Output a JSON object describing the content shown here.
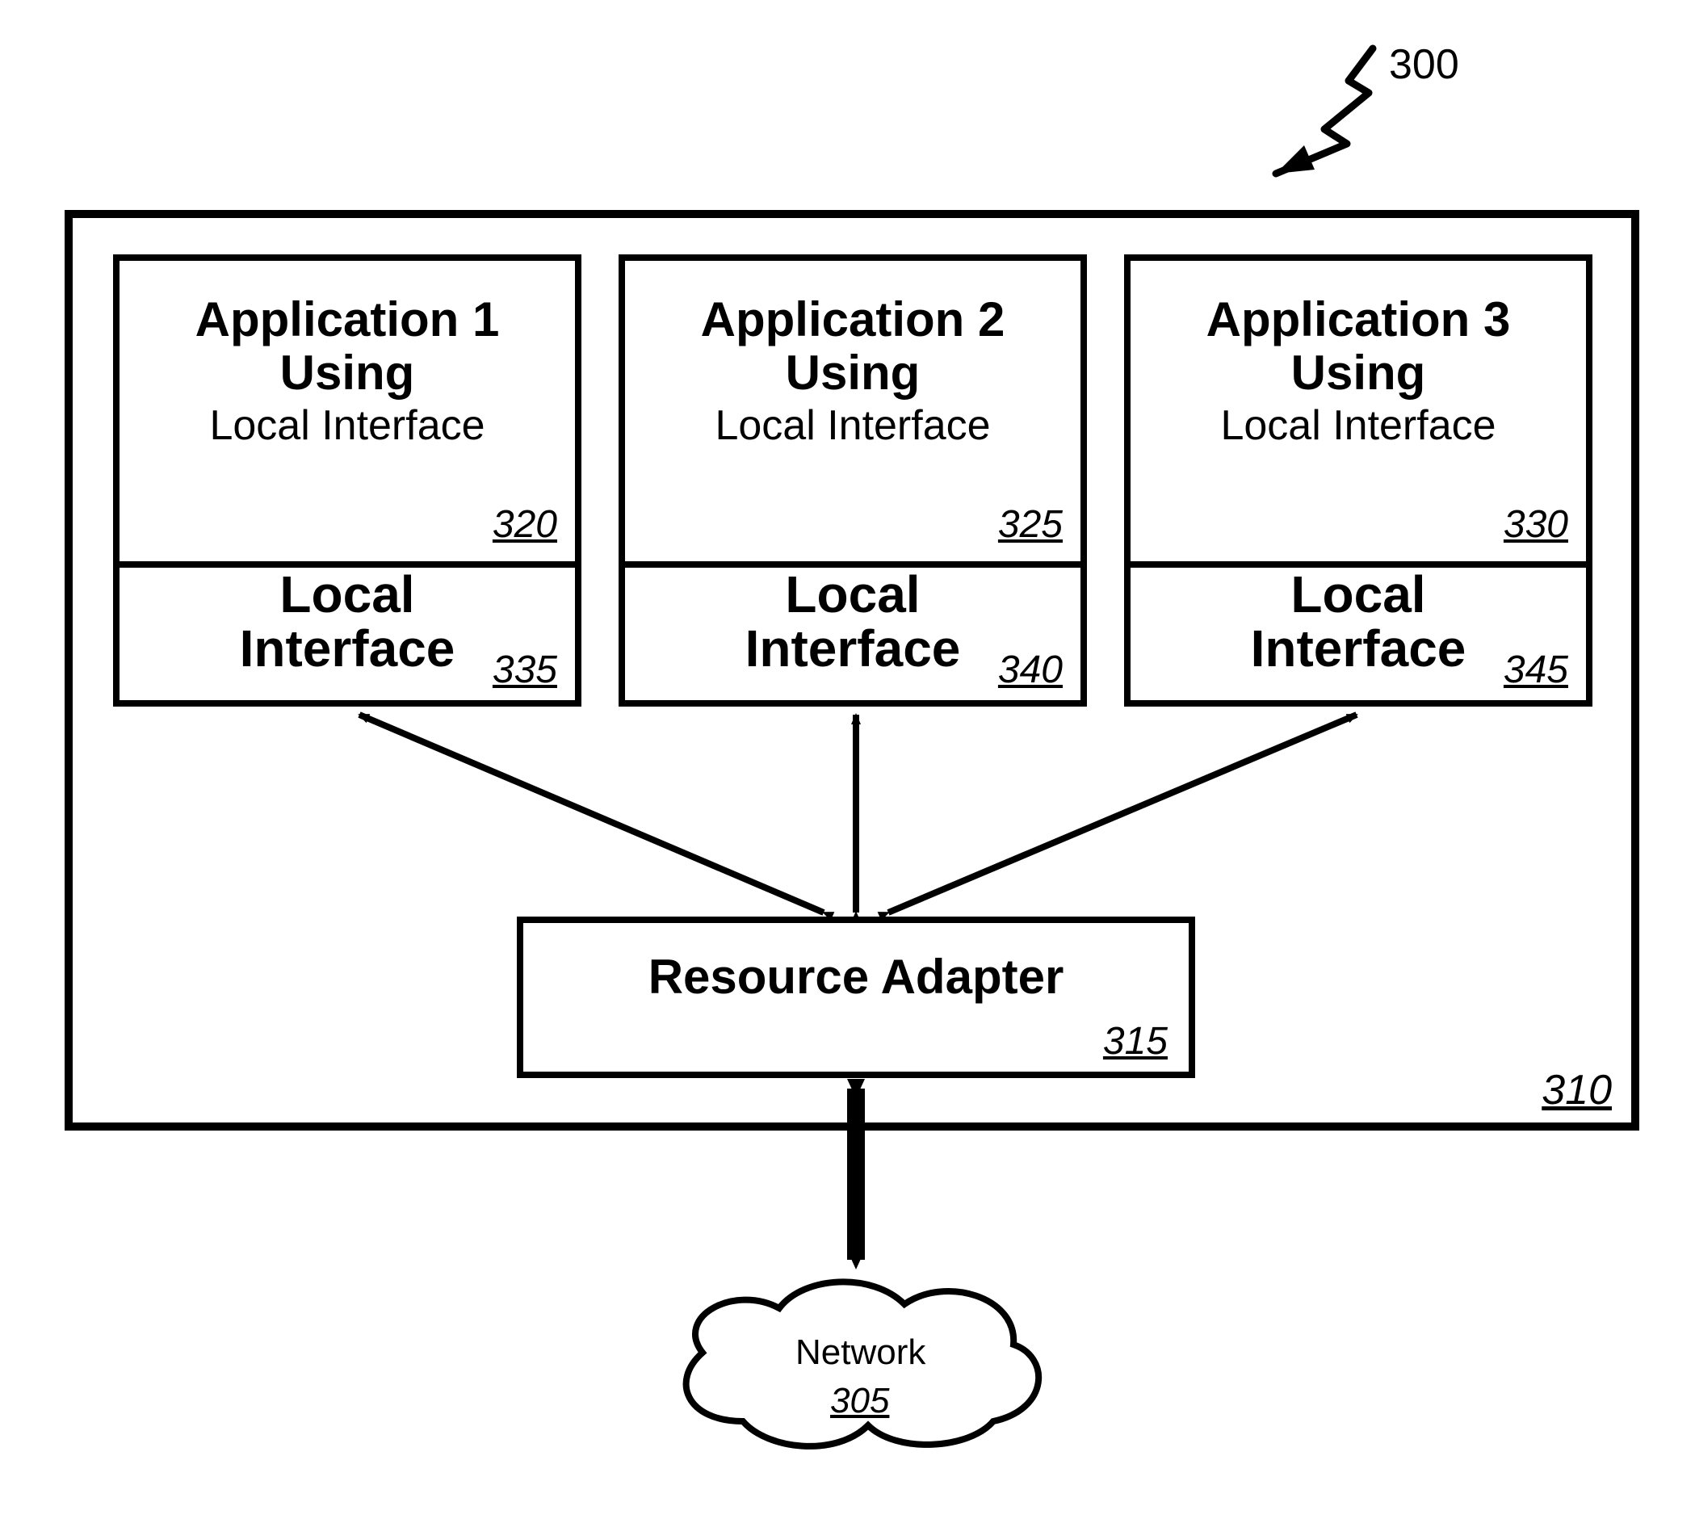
{
  "figure": {
    "ref_main": "300",
    "container_ref": "310"
  },
  "apps": [
    {
      "title_line1": "Application 1",
      "title_line2": "Using",
      "subtitle": "Local Interface",
      "ref": "320",
      "local_label": "Local\nInterface",
      "local_ref": "335"
    },
    {
      "title_line1": "Application 2",
      "title_line2": "Using",
      "subtitle": "Local Interface",
      "ref": "325",
      "local_label": "Local\nInterface",
      "local_ref": "340"
    },
    {
      "title_line1": "Application 3",
      "title_line2": "Using",
      "subtitle": "Local Interface",
      "ref": "330",
      "local_label": "Local\nInterface",
      "local_ref": "345"
    }
  ],
  "adapter": {
    "label": "Resource Adapter",
    "ref": "315"
  },
  "network": {
    "label": "Network",
    "ref": "305"
  }
}
